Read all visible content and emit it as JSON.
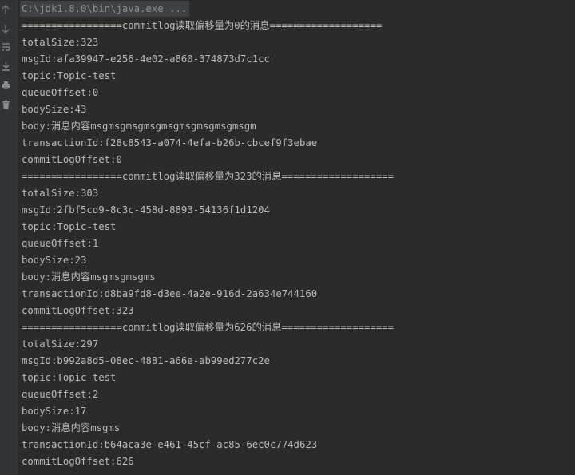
{
  "console": {
    "command": "C:\\jdk1.8.0\\bin\\java.exe ...",
    "lines": [
      "=================commitlog读取偏移量为0的消息===================",
      "totalSize:323",
      "msgId:afa39947-e256-4e02-a860-374873d7c1cc",
      "topic:Topic-test",
      "queueOffset:0",
      "bodySize:43",
      "body:消息内容msgmsgmsgmsgmsgmsgmsgmsgmsgm",
      "transactionId:f28c8543-a074-4efa-b26b-cbcef9f3ebae",
      "commitLogOffset:0",
      "=================commitlog读取偏移量为323的消息===================",
      "totalSize:303",
      "msgId:2fbf5cd9-8c3c-458d-8893-54136f1d1204",
      "topic:Topic-test",
      "queueOffset:1",
      "bodySize:23",
      "body:消息内容msgmsgmsgms",
      "transactionId:d8ba9fd8-d3ee-4a2e-916d-2a634e744160",
      "commitLogOffset:323",
      "=================commitlog读取偏移量为626的消息===================",
      "totalSize:297",
      "msgId:b992a8d5-08ec-4881-a66e-ab99ed277c2e",
      "topic:Topic-test",
      "queueOffset:2",
      "bodySize:17",
      "body:消息内容msgms",
      "transactionId:b64aca3e-e461-45cf-ac85-6ec0c774d623",
      "commitLogOffset:626"
    ]
  },
  "toolbar": {
    "icons": [
      "arrow-up-icon",
      "arrow-down-icon",
      "soft-wrap-icon",
      "scroll-to-end-icon",
      "print-icon",
      "trash-icon"
    ]
  },
  "colors": {
    "background": "#2b2b2b",
    "gutter": "#313335",
    "text": "#b9bcba",
    "command_text": "#8c8f91"
  }
}
